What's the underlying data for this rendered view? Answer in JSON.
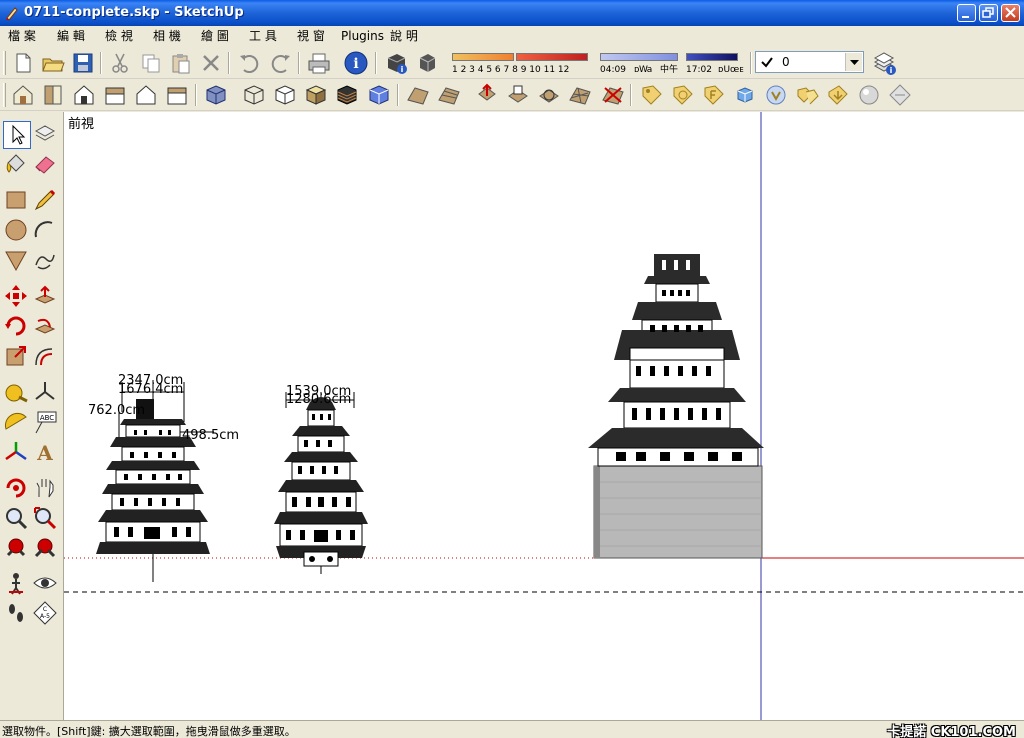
{
  "window": {
    "title": "0711-conplete.skp - SketchUp",
    "minimize_icon": "minimize-icon",
    "restore_icon": "restore-icon",
    "close_icon": "close-icon"
  },
  "menu": {
    "items": [
      "檔 案",
      "編 輯",
      "檢 視",
      "相 機",
      "繪 圖",
      "工 具",
      "視 窗",
      "Plugins",
      "說 明"
    ]
  },
  "shadow_settings": {
    "month_labels": "1  2  3  4  5  6  7  8  9  10 11 12",
    "time_start": "04:09",
    "time_mid": "中午",
    "time_end": "17:02",
    "extra": "ᴅUœᴇ",
    "lighting_label": "ᴅWa"
  },
  "layers": {
    "current": "0"
  },
  "canvas": {
    "view_name": "前視",
    "dimensions": {
      "d1": "2347.0cm",
      "d2": "1676.4cm",
      "d3": "762.0cm",
      "d4": "498.5cm",
      "d5": "1539.0cm",
      "d6": "1280.6cm"
    }
  },
  "status": {
    "text": "選取物件。[Shift]鍵: 擴大選取範圍，拖曳滑鼠做多重選取。",
    "watermark": "卡提諾 CK101.COM"
  },
  "colors": {
    "titlebar": "#0a4fc8",
    "chrome": "#ece9d8",
    "canvas": "#ffffff",
    "axis_red": "#cc0000",
    "axis_blue": "#3333aa",
    "axis_green": "#00a000",
    "roof": "#2b2b2b",
    "stone": "#b8b8b8"
  }
}
